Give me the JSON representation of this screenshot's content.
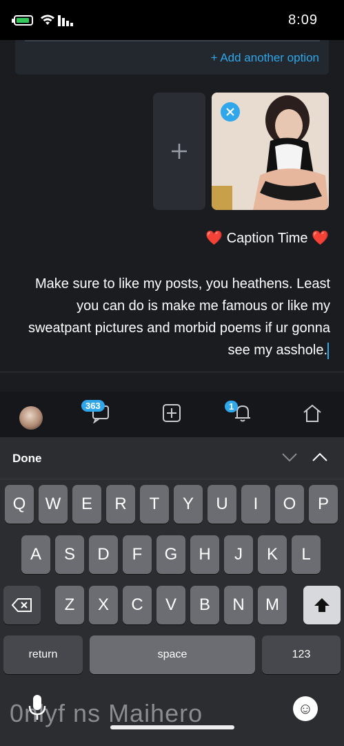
{
  "status_bar": {
    "time": "8:09"
  },
  "composer": {
    "add_option": "+ Add another option",
    "add_media_icon": "plus-icon",
    "remove_icon": "close-icon",
    "caption_title": "❤️ Caption Time ❤️",
    "body_text": "Make sure to like my posts, you heathens. Least you can do is make me famous or like my sweatpant pictures and morbid poems if ur gonna see my asshole."
  },
  "nav": {
    "messages_badge": "363",
    "notifications_badge": "1"
  },
  "keyboard": {
    "done_label": "Done",
    "row1": [
      "Q",
      "W",
      "E",
      "R",
      "T",
      "Y",
      "U",
      "I",
      "O",
      "P"
    ],
    "row2": [
      "A",
      "S",
      "D",
      "F",
      "G",
      "H",
      "J",
      "K",
      "L"
    ],
    "row3": [
      "Z",
      "X",
      "C",
      "V",
      "B",
      "N",
      "M"
    ],
    "numbers_label": "123",
    "space_label": "space",
    "return_label": "return"
  },
  "footer": {
    "text": "0nlyf ns Maihero"
  },
  "colors": {
    "accent": "#2fa7ea",
    "background": "#1b1c20"
  }
}
